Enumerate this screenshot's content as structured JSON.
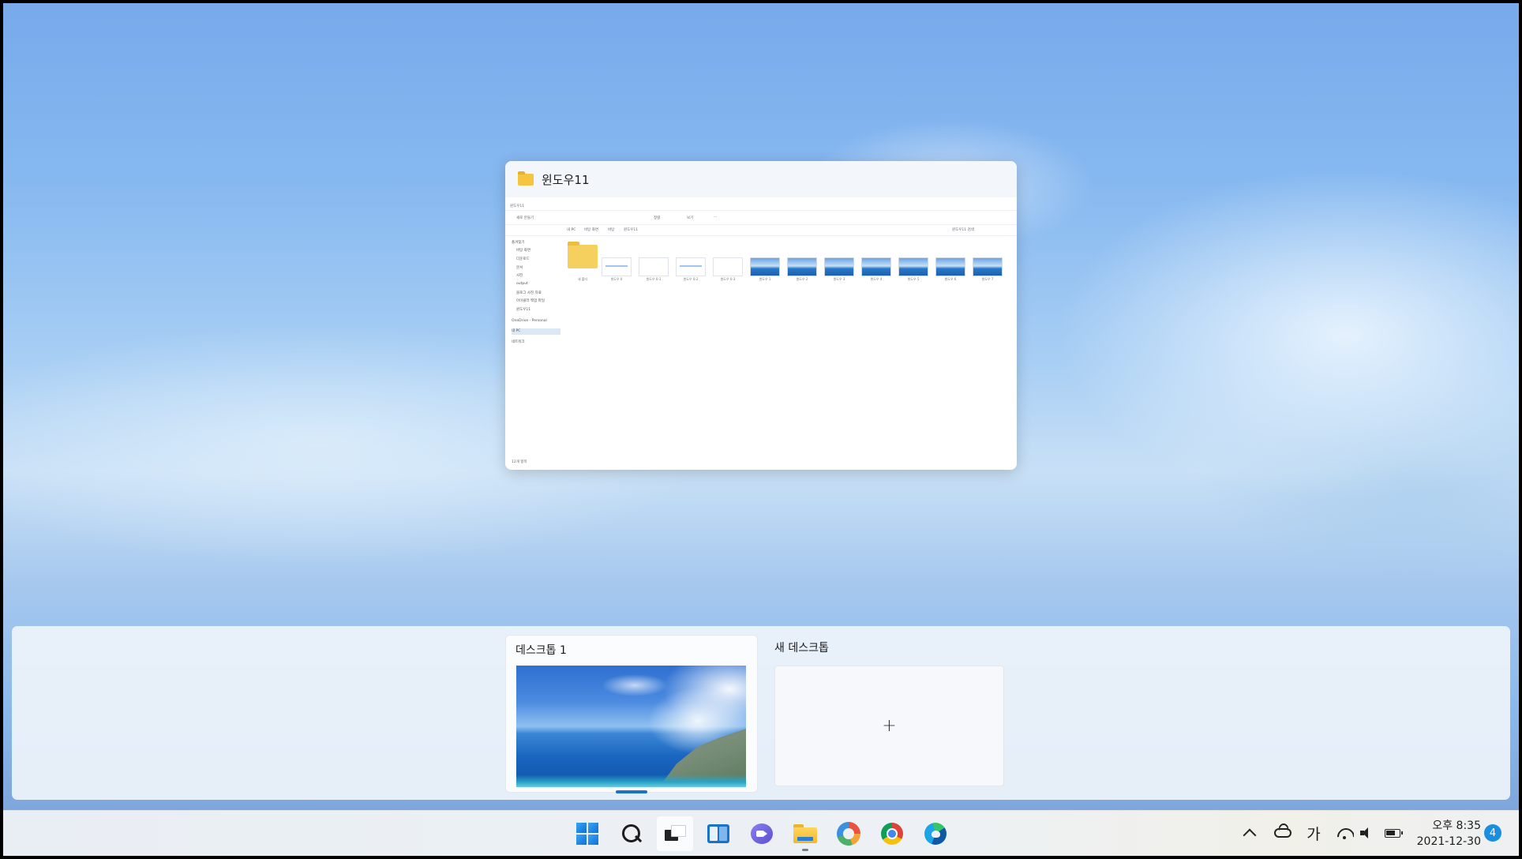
{
  "window_preview": {
    "title": "윈도우11",
    "inner": {
      "breadcrumb_title": "윈도우11",
      "toolbar": [
        "새로 만들기",
        "정렬",
        "보기",
        "···"
      ],
      "path": [
        "내 PC",
        "바탕 화면",
        "바탕",
        "윈도우11"
      ],
      "search_placeholder": "윈도우11 검색",
      "nav_items": [
        "즐겨찾기",
        "바탕 화면",
        "다운로드",
        "문서",
        "사진",
        "output",
        "블로그 사진 자료",
        "아이클라 백업 파일",
        "윈도우11",
        "OneDrive - Personal",
        "내 PC",
        "네트워크"
      ],
      "files": [
        "새 폴더",
        "윈도우 0",
        "윈도우 0-1",
        "윈도우 0-2",
        "윈도우 0-3",
        "윈도우 1",
        "윈도우 2",
        "윈도우 3",
        "윈도우 4",
        "윈도우 5",
        "윈도우 6",
        "윈도우 7"
      ],
      "status": "12개 항목"
    }
  },
  "desktops": {
    "desktop1_label": "데스크톱 1",
    "new_desktop_label": "새 데스크톱",
    "add_symbol": "+"
  },
  "taskbar": {
    "icons": [
      "start-icon",
      "search-icon",
      "task-view-icon",
      "widgets-icon",
      "chat-icon",
      "file-explorer-icon",
      "navigation-app-icon",
      "chrome-icon",
      "edge-icon"
    ]
  },
  "tray": {
    "ime": "가",
    "time": "오후 8:35",
    "date": "2021-12-30",
    "notification_count": "4"
  }
}
